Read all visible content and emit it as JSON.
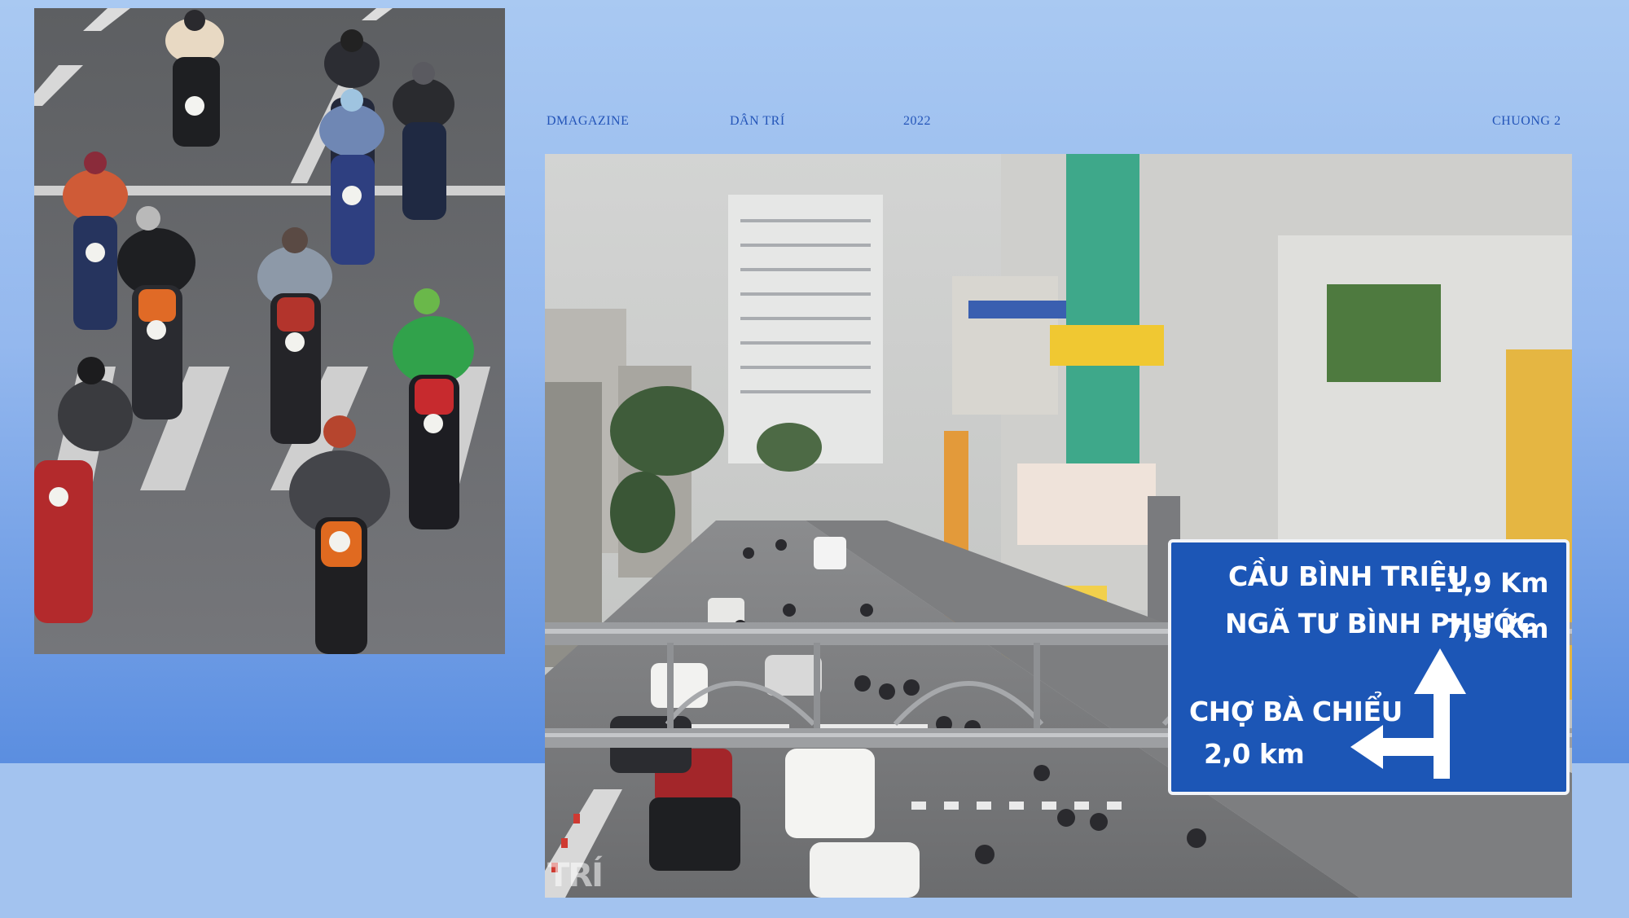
{
  "header": {
    "brand": "DMAGAZINE",
    "site": "DÂN TRÍ",
    "year": "2022",
    "chapter": "CHUONG 2"
  },
  "road_sign": {
    "line1_place": "CẦU BÌNH TRIỆU",
    "line1_distance": "1,9 Km",
    "line2_place": "NGÃ TƯ BÌNH PHƯỚC",
    "line2_distance": "7,5 Km",
    "line3_place": "CHỢ BÀ CHIỂU",
    "line3_distance": "2,0 km"
  },
  "photo_right": {
    "watermark": "TRÍ"
  },
  "colors": {
    "accent_text": "#2455b8",
    "sign_blue": "#1c56b6",
    "background_light": "#a9c9f2",
    "background_deep": "#5b8ee0"
  }
}
